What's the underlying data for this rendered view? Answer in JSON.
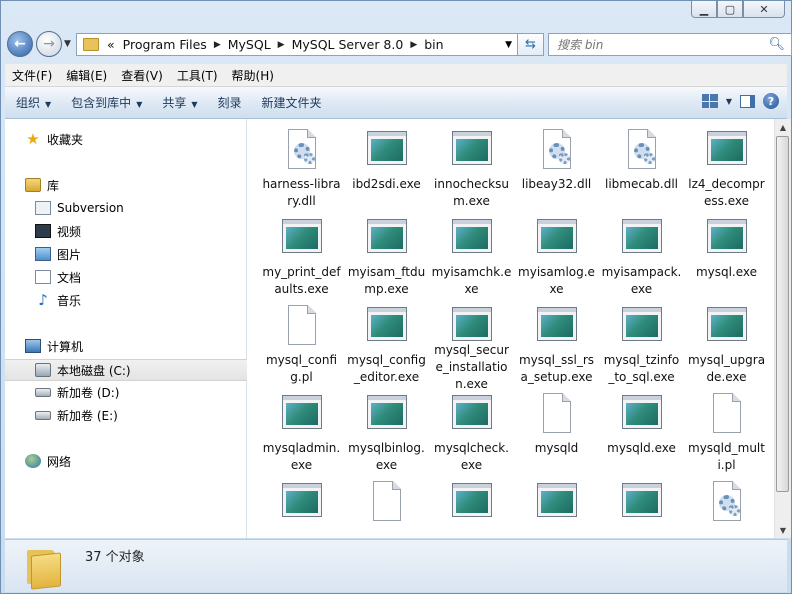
{
  "window": {
    "caption_buttons": [
      "minimize",
      "maximize",
      "close"
    ]
  },
  "address": {
    "overflow": "«",
    "crumbs": [
      "Program Files",
      "MySQL",
      "MySQL Server 8.0",
      "bin"
    ],
    "search_placeholder": "搜索 bin"
  },
  "menu": {
    "items": [
      "文件(F)",
      "编辑(E)",
      "查看(V)",
      "工具(T)",
      "帮助(H)"
    ]
  },
  "toolbar": {
    "organize": "组织",
    "include_library": "包含到库中",
    "share": "共享",
    "burn": "刻录",
    "new_folder": "新建文件夹"
  },
  "nav": {
    "favorites": "收藏夹",
    "libraries": "库",
    "lib_items": [
      "Subversion",
      "视频",
      "图片",
      "文档",
      "音乐"
    ],
    "computer": "计算机",
    "drives": [
      "本地磁盘 (C:)",
      "新加卷 (D:)",
      "新加卷 (E:)"
    ],
    "network": "网络"
  },
  "files": [
    {
      "name": "harness-library.dll",
      "type": "dll"
    },
    {
      "name": "ibd2sdi.exe",
      "type": "exe"
    },
    {
      "name": "innochecksum.exe",
      "type": "exe"
    },
    {
      "name": "libeay32.dll",
      "type": "dll"
    },
    {
      "name": "libmecab.dll",
      "type": "dll"
    },
    {
      "name": "lz4_decompress.exe",
      "type": "exe"
    },
    {
      "name": "my_print_defaults.exe",
      "type": "exe"
    },
    {
      "name": "myisam_ftdump.exe",
      "type": "exe"
    },
    {
      "name": "myisamchk.exe",
      "type": "exe"
    },
    {
      "name": "myisamlog.exe",
      "type": "exe"
    },
    {
      "name": "myisampack.exe",
      "type": "exe"
    },
    {
      "name": "mysql.exe",
      "type": "exe"
    },
    {
      "name": "mysql_config.pl",
      "type": "blank"
    },
    {
      "name": "mysql_config_editor.exe",
      "type": "exe"
    },
    {
      "name": "mysql_secure_installation.exe",
      "type": "exe"
    },
    {
      "name": "mysql_ssl_rsa_setup.exe",
      "type": "exe"
    },
    {
      "name": "mysql_tzinfo_to_sql.exe",
      "type": "exe"
    },
    {
      "name": "mysql_upgrade.exe",
      "type": "exe"
    },
    {
      "name": "mysqladmin.exe",
      "type": "exe"
    },
    {
      "name": "mysqlbinlog.exe",
      "type": "exe"
    },
    {
      "name": "mysqlcheck.exe",
      "type": "exe"
    },
    {
      "name": "mysqld",
      "type": "blank"
    },
    {
      "name": "mysqld.exe",
      "type": "exe"
    },
    {
      "name": "mysqld_multi.pl",
      "type": "blank"
    },
    {
      "name": "",
      "type": "exe"
    },
    {
      "name": "",
      "type": "blank"
    },
    {
      "name": "",
      "type": "exe"
    },
    {
      "name": "",
      "type": "exe"
    },
    {
      "name": "",
      "type": "exe"
    },
    {
      "name": "",
      "type": "dll"
    }
  ],
  "status": {
    "count": "37 个对象"
  }
}
